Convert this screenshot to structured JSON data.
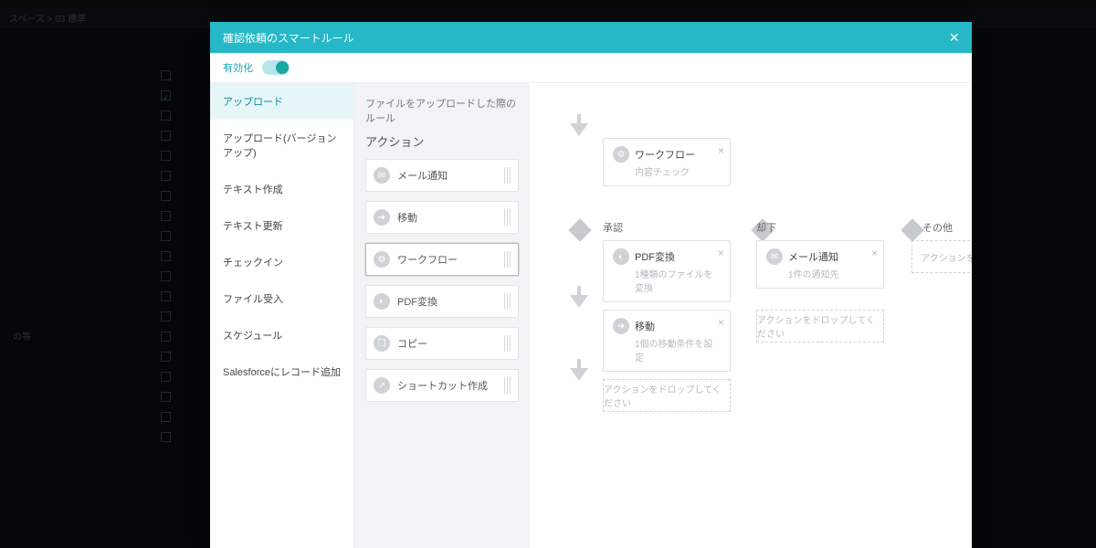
{
  "bg": {
    "breadcrumb": "スペース  >  03 標準",
    "sidebar_text": "の等"
  },
  "modal": {
    "title": "確認依頼のスマートルール",
    "enable_label": "有効化",
    "section_title": "ファイルをアップロードした際のルール",
    "actions_title": "アクション"
  },
  "nav": {
    "items": [
      "アップロード",
      "アップロード(バージョンアップ)",
      "テキスト作成",
      "テキスト更新",
      "チェックイン",
      "ファイル受入",
      "スケジュール",
      "Salesforceにレコード追加"
    ]
  },
  "palette": {
    "mail": "メール通知",
    "move": "移動",
    "workflow": "ワークフロー",
    "pdf": "PDF変換",
    "copy": "コピー",
    "shortcut": "ショートカット作成"
  },
  "flow": {
    "workflow": {
      "title": "ワークフロー",
      "sub": "内容チェック"
    },
    "branch_approve": "承認",
    "branch_reject": "却下",
    "branch_other": "その他",
    "pdf": {
      "title": "PDF変換",
      "sub": "1種類のファイルを変換"
    },
    "mail": {
      "title": "メール通知",
      "sub": "1件の通知先"
    },
    "move": {
      "title": "移動",
      "sub": "1個の移動条件を設定"
    },
    "dropzone": "アクションをドロップしてください",
    "dropzone_short": "アクションをドロッ"
  }
}
